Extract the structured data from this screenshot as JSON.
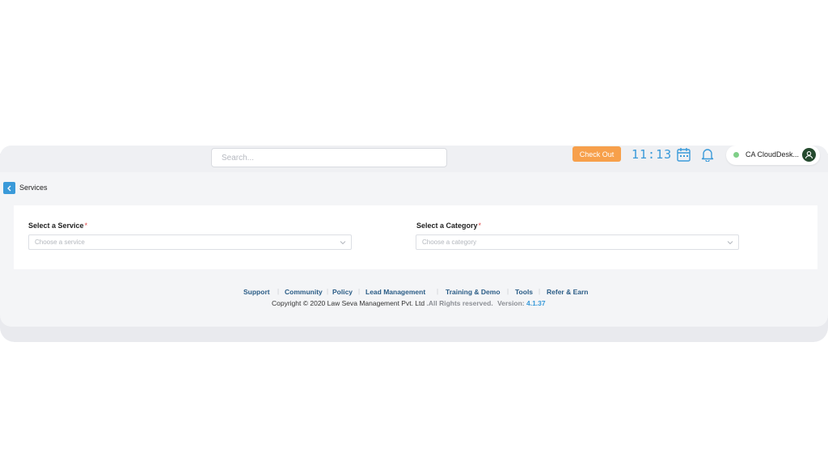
{
  "topbar": {
    "search_placeholder": "Search...",
    "checkout_label": "Check Out",
    "time": "11:13",
    "user_name": "CA CloudDesk..."
  },
  "breadcrumb": {
    "title": "Services"
  },
  "form": {
    "service": {
      "label": "Select a Service",
      "required_mark": "*",
      "placeholder": "Choose a service"
    },
    "category": {
      "label": "Select a Category",
      "required_mark": "*",
      "placeholder": "Choose a category"
    }
  },
  "footer": {
    "links": [
      "Support",
      "Community",
      "Policy",
      "Lead Management",
      "Training & Demo",
      "Tools",
      "Refer & Earn"
    ],
    "copyright": "Copyright © 2020 Law Seva Management Pvt. Ltd",
    "rights": " .All Rights reserved.",
    "version_label": "Version:",
    "version": "4.1.37"
  },
  "colors": {
    "accent": "#3a9ad9",
    "checkout": "#f7a04b",
    "footer_link": "#2a5c86",
    "status_online": "#7fcf88"
  }
}
